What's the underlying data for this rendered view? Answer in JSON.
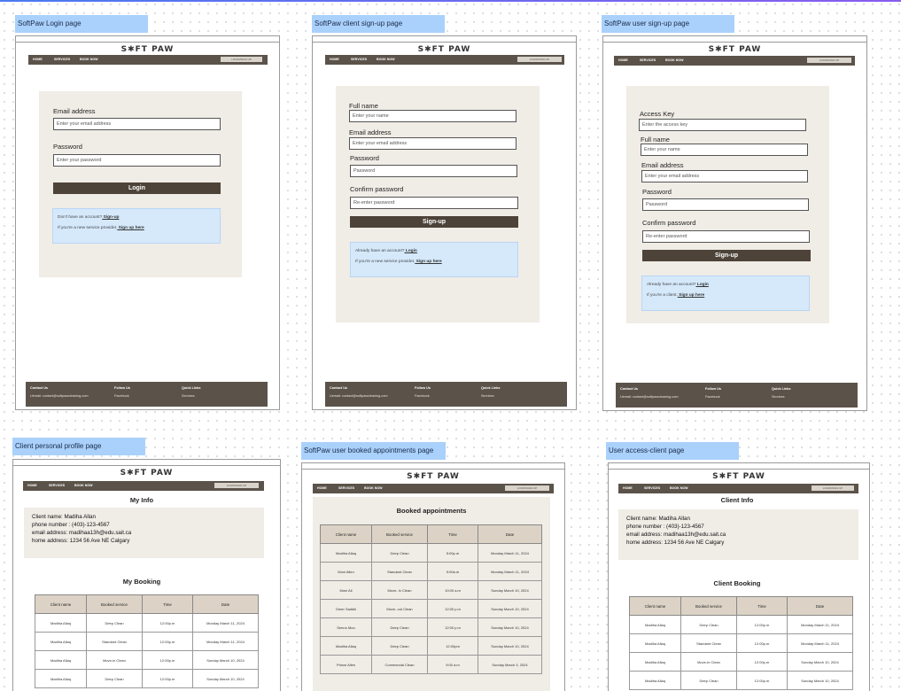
{
  "frames": {
    "login": {
      "label": "SoftPaw Login page",
      "logo": "S✱FT PAW",
      "nav": [
        "HOME",
        "SERVICES",
        "BOOK NOW"
      ],
      "nav_button": "LOGIN/SIGN UP",
      "email_label": "Email address",
      "email_placeholder": "Enter your email address",
      "password_label": "Password",
      "password_placeholder": "Enter your password",
      "submit": "Login",
      "note_line1": "Don't have an account?",
      "note_link1": " Sign-up",
      "note_line2": "If you're a new service provider,",
      "note_link2": " Sign up here",
      "footer": {
        "contact_title": "Contact Us",
        "contact_text": "Uemail: contact@softpawcleaning.com",
        "follow_title": "Follow Us",
        "follow_text": "Facebook",
        "quick_title": "Quick Links",
        "quick_text": "Services"
      }
    },
    "client_signup": {
      "label": "SoftPaw client sign-up page",
      "logo": "S✱FT PAW",
      "nav": [
        "HOME",
        "SERVICES",
        "BOOK NOW"
      ],
      "nav_button": "LOGIN/SIGN UP",
      "fullname_label": "Full name",
      "fullname_placeholder": "Enter your name",
      "email_label": "Email address",
      "email_placeholder": "Enter your email address",
      "password_label": "Password",
      "password_placeholder": "Password",
      "confirm_label": "Confirm password",
      "confirm_placeholder": "Re-enter password",
      "submit": "Sign-up",
      "note_line1": "Already have an account?",
      "note_link1": " Login",
      "note_line2": "If you're a new service provider,",
      "note_link2": " Sign up here",
      "footer": {
        "contact_title": "Contact Us",
        "contact_text": "Uemail: contact@softpawcleaning.com",
        "follow_title": "Follow Us",
        "follow_text": "Facebook",
        "quick_title": "Quick Links",
        "quick_text": "Services"
      }
    },
    "user_signup": {
      "label": "SoftPaw user sign-up page",
      "logo": "S✱FT PAW",
      "nav": [
        "HOME",
        "SERVICES",
        "BOOK NOW"
      ],
      "nav_button": "LOGIN/SIGN UP",
      "access_label": "Access Key",
      "access_placeholder": "Enter the access key",
      "fullname_label": "Full name",
      "fullname_placeholder": "Enter your name",
      "email_label": "Email address",
      "email_placeholder": "Enter your email address",
      "password_label": "Password",
      "password_placeholder": "Password",
      "confirm_label": "Confirm password",
      "confirm_placeholder": "Re-enter password",
      "submit": "Sign-up",
      "note_line1": "Already have an account?",
      "note_link1": " Login",
      "note_line2": "If you're a client,",
      "note_link2": " Sign up here",
      "footer": {
        "contact_title": "Contact Us",
        "contact_text": "Uemail: contact@softpawcleaning.com",
        "follow_title": "Follow Us",
        "follow_text": "Facebook",
        "quick_title": "Quick Links",
        "quick_text": "Services"
      }
    },
    "client_profile": {
      "label": "Client personal profile page",
      "logo": "S✱FT PAW",
      "nav": [
        "HOME",
        "SERVICES",
        "BOOK NOW"
      ],
      "nav_button": "LOGIN/SIGN UP",
      "info_title": "My Info",
      "info_lines": [
        "Client name: Madiha Allan",
        "phone number : (403)-123-4567",
        "email address:  madihaa13h@edu.sait.ca",
        "home address:  1234 56 Ave NE Calgary"
      ],
      "booking_title": "My Booking",
      "columns": [
        "Client name",
        "Booked service",
        "Time",
        "Date"
      ],
      "rows": [
        [
          "Madiha Allaq",
          "Deep Clean",
          "12:00p.m",
          "Monday  March 11, 2024"
        ],
        [
          "Madiha Allaq",
          "Standard Clean",
          "12:00p.m",
          "Monday  March 11, 2024"
        ],
        [
          "Madiha Allaq",
          "Move-in Clean",
          "12:00p.m",
          "Sunday  March 10, 2024"
        ],
        [
          "Madiha Allaq",
          "Deep Clean",
          "12:00p.m",
          "Sunday  March 10, 2024"
        ]
      ]
    },
    "booked_appointments": {
      "label": "SoftPaw user booked appointments page",
      "logo": "S✱FT PAW",
      "nav": [
        "HOME",
        "SERVICES",
        "BOOK NOW"
      ],
      "nav_button": "LOGIN/SIGN UP",
      "title": "Booked appointments",
      "columns": [
        "Client name",
        "Booked service",
        "Time",
        "Date"
      ],
      "rows": [
        [
          "Madiha Allaq",
          "Deep Clean",
          "5:00p.m",
          "Monday  March 11, 2024"
        ],
        [
          "Moni Allen",
          "Standard Clean",
          "9:00a.m",
          "Monday  March 11, 2024"
        ],
        [
          "Moni Ali",
          "Move- in Clean",
          "10:00 a.m",
          "Sunday  March 10, 2024"
        ],
        [
          "Omer Saddik",
          "Move- out Clean",
          "12:00 p.m",
          "Sunday  March 10, 2024"
        ],
        [
          "Sennu  Mou",
          "Deep Clean",
          "12:00 p.m",
          "Sunday March 10, 2024"
        ],
        [
          "Madiha Allaq",
          "Deep Clean",
          "12:00pm",
          "Sunday March 10, 2024"
        ],
        [
          "Prince Allen",
          "Commercial Clean",
          "9:00 a.m",
          "Sunday  March 3, 2024"
        ]
      ]
    },
    "access_client": {
      "label": "User access-client page",
      "logo": "S✱FT PAW",
      "nav": [
        "HOME",
        "SERVICES",
        "BOOK NOW"
      ],
      "nav_button": "LOGIN/SIGN UP",
      "info_title": "Client Info",
      "info_lines": [
        "Client name: Madiha Allan",
        "phone number : (403)-123-4567",
        "email address:  madihaa13h@edu.sait.ca",
        "home address:  1234 56 Ave NE Calgary"
      ],
      "booking_title": "Client Booking",
      "columns": [
        "Client name",
        "Booked service",
        "Time",
        "Date"
      ],
      "rows": [
        [
          "Madiha Allaq",
          "Deep Clean",
          "12:00p.m",
          "Monday  March 11, 2024"
        ],
        [
          "Madiha Allaq",
          "Standard Clean",
          "12:00p.m",
          "Monday  March 11, 2024"
        ],
        [
          "Madiha Allaq",
          "Move-in Clean",
          "12:00p.m",
          "Sunday  March 10, 2024"
        ],
        [
          "Madiha Allaq",
          "Deep Clean",
          "12:00p.m",
          "Sunday  March 10, 2024"
        ]
      ]
    }
  }
}
